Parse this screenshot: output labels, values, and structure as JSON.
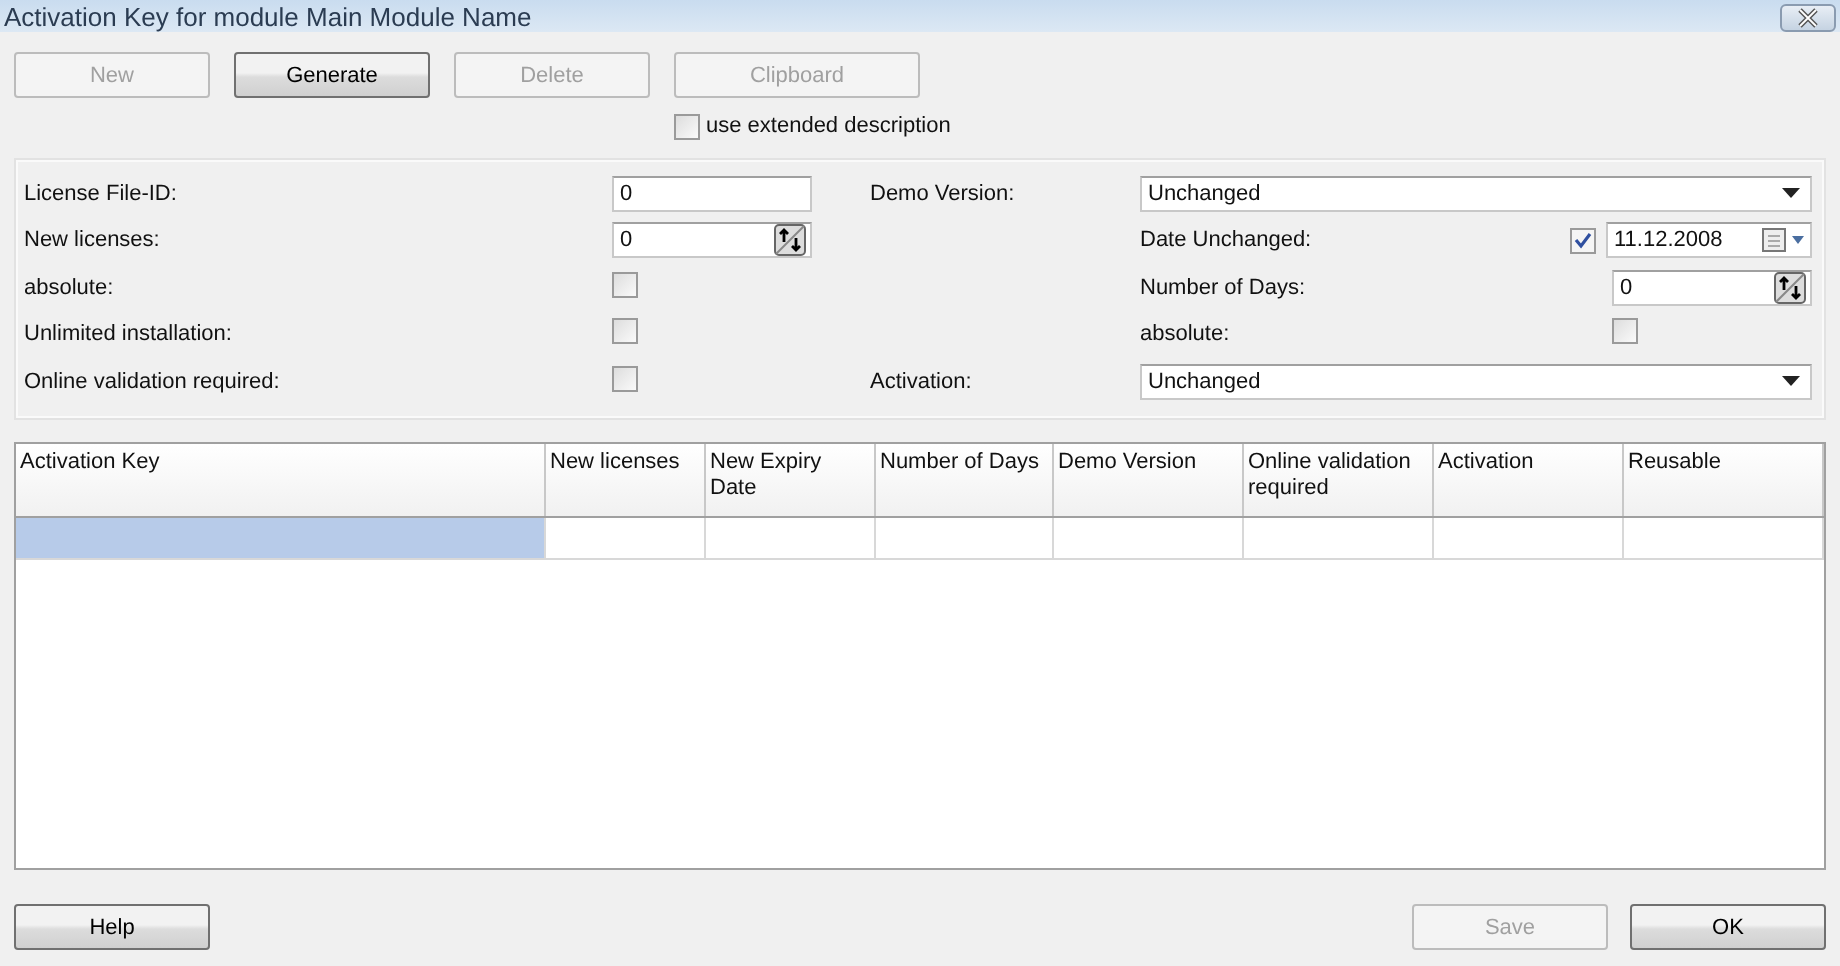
{
  "window": {
    "title": "Activation Key for module Main Module Name"
  },
  "toolbar": [
    {
      "label": "New",
      "disabled": true
    },
    {
      "label": "Generate",
      "disabled": false
    },
    {
      "label": "Delete",
      "disabled": true
    },
    {
      "label": "Clipboard",
      "disabled": true
    }
  ],
  "extended_description": {
    "label": "use extended description",
    "checked": false
  },
  "form": {
    "left": [
      {
        "kind": "text",
        "label": "License File-ID:",
        "value": "0"
      },
      {
        "kind": "spin",
        "label": "New licenses:",
        "value": "0"
      },
      {
        "kind": "checkbox",
        "label": "absolute:",
        "checked": false
      },
      {
        "kind": "checkbox",
        "label": "Unlimited installation:",
        "checked": false
      },
      {
        "kind": "checkbox",
        "label": "Online validation required:",
        "checked": false
      }
    ],
    "right": [
      {
        "kind": "combo",
        "label": "Demo Version:",
        "value": "Unchanged"
      },
      {
        "kind": "date",
        "label": "Date Unchanged:",
        "checked": true,
        "value": "11.12.2008"
      },
      {
        "kind": "spin",
        "label": "Number of Days:",
        "value": "0"
      },
      {
        "kind": "checkbox",
        "label": "absolute:",
        "checked": false
      },
      {
        "kind": "combo",
        "label": "Activation:",
        "value": "Unchanged"
      }
    ]
  },
  "table": {
    "columns": [
      "Activation Key",
      "New licenses",
      "New Expiry Date",
      "Number of Days",
      "Demo Version",
      "Online validation required",
      "Activation",
      "Reusable"
    ],
    "rows": [
      {
        "selected": true
      }
    ]
  },
  "footer": {
    "left": [
      {
        "label": "Help",
        "disabled": false
      }
    ],
    "right": [
      {
        "label": "Save",
        "disabled": true
      },
      {
        "label": "OK",
        "disabled": false
      }
    ]
  }
}
